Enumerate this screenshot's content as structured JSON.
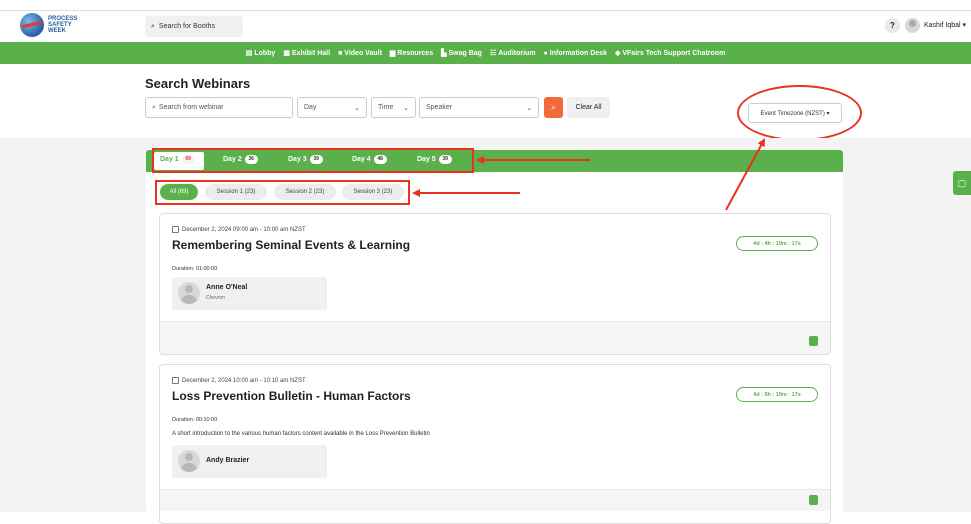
{
  "header": {
    "logo_text": "PROCESS SAFETY WEEK",
    "search_placeholder": "Search for Booths",
    "help_label": "?",
    "user_name": "Kashif Iqbal ▾"
  },
  "nav": {
    "items": [
      {
        "icon": "▤",
        "label": "Lobby"
      },
      {
        "icon": "▦",
        "label": "Exhibit Hall"
      },
      {
        "icon": "■",
        "label": "Video Vault"
      },
      {
        "icon": "▆",
        "label": "Resources"
      },
      {
        "icon": "▙",
        "label": "Swag Bag"
      },
      {
        "icon": "☷",
        "label": "Auditorium"
      },
      {
        "icon": "●",
        "label": "Information Desk"
      },
      {
        "icon": "◆",
        "label": "VFairs Tech Support Chatroom"
      }
    ]
  },
  "search": {
    "title": "Search Webinars",
    "placeholder": "Search from webinar",
    "day_label": "Day",
    "time_label": "Time",
    "speaker_label": "Speaker",
    "clear_label": "Clear All",
    "timezone_label": "Event Timezone (NZST) ▾"
  },
  "days": [
    {
      "label": "Day 1",
      "count": "69",
      "active": true
    },
    {
      "label": "Day 2",
      "count": "36",
      "active": false
    },
    {
      "label": "Day 3",
      "count": "39",
      "active": false
    },
    {
      "label": "Day 4",
      "count": "48",
      "active": false
    },
    {
      "label": "Day 5",
      "count": "39",
      "active": false
    }
  ],
  "sessions": [
    {
      "label": "All (69)",
      "active": true
    },
    {
      "label": "Session 1 (23)",
      "active": false
    },
    {
      "label": "Session 2 (23)",
      "active": false
    },
    {
      "label": "Session 3 (23)",
      "active": false
    }
  ],
  "webinars": [
    {
      "date": "December 2, 2024 09:00 am - 10:00 am NZST",
      "title": "Remembering Seminal Events & Learning",
      "countdown": "4d : 4h : 19m : 17s",
      "duration": "Duration: 01:00:00",
      "description": "",
      "speaker_name": "Anne O'Neal",
      "speaker_org": "Chevron"
    },
    {
      "date": "December 2, 2024 10:00 am - 10:10 am NZST",
      "title": "Loss Prevention Bulletin - Human Factors",
      "countdown": "4d : 5h : 19m : 17s",
      "duration": "Duration: 00:10:00",
      "description": "A short introduction to the various human factors content available in the Loss Prevention Bulletin",
      "speaker_name": "Andy Brazier",
      "speaker_org": ""
    }
  ],
  "colors": {
    "brand_green": "#5ab04b",
    "search_orange": "#f26a3a",
    "annotation_red": "#e8331f"
  },
  "icons": {
    "search": "search-icon",
    "chat": "chat-icon",
    "calendar": "calendar-icon"
  }
}
